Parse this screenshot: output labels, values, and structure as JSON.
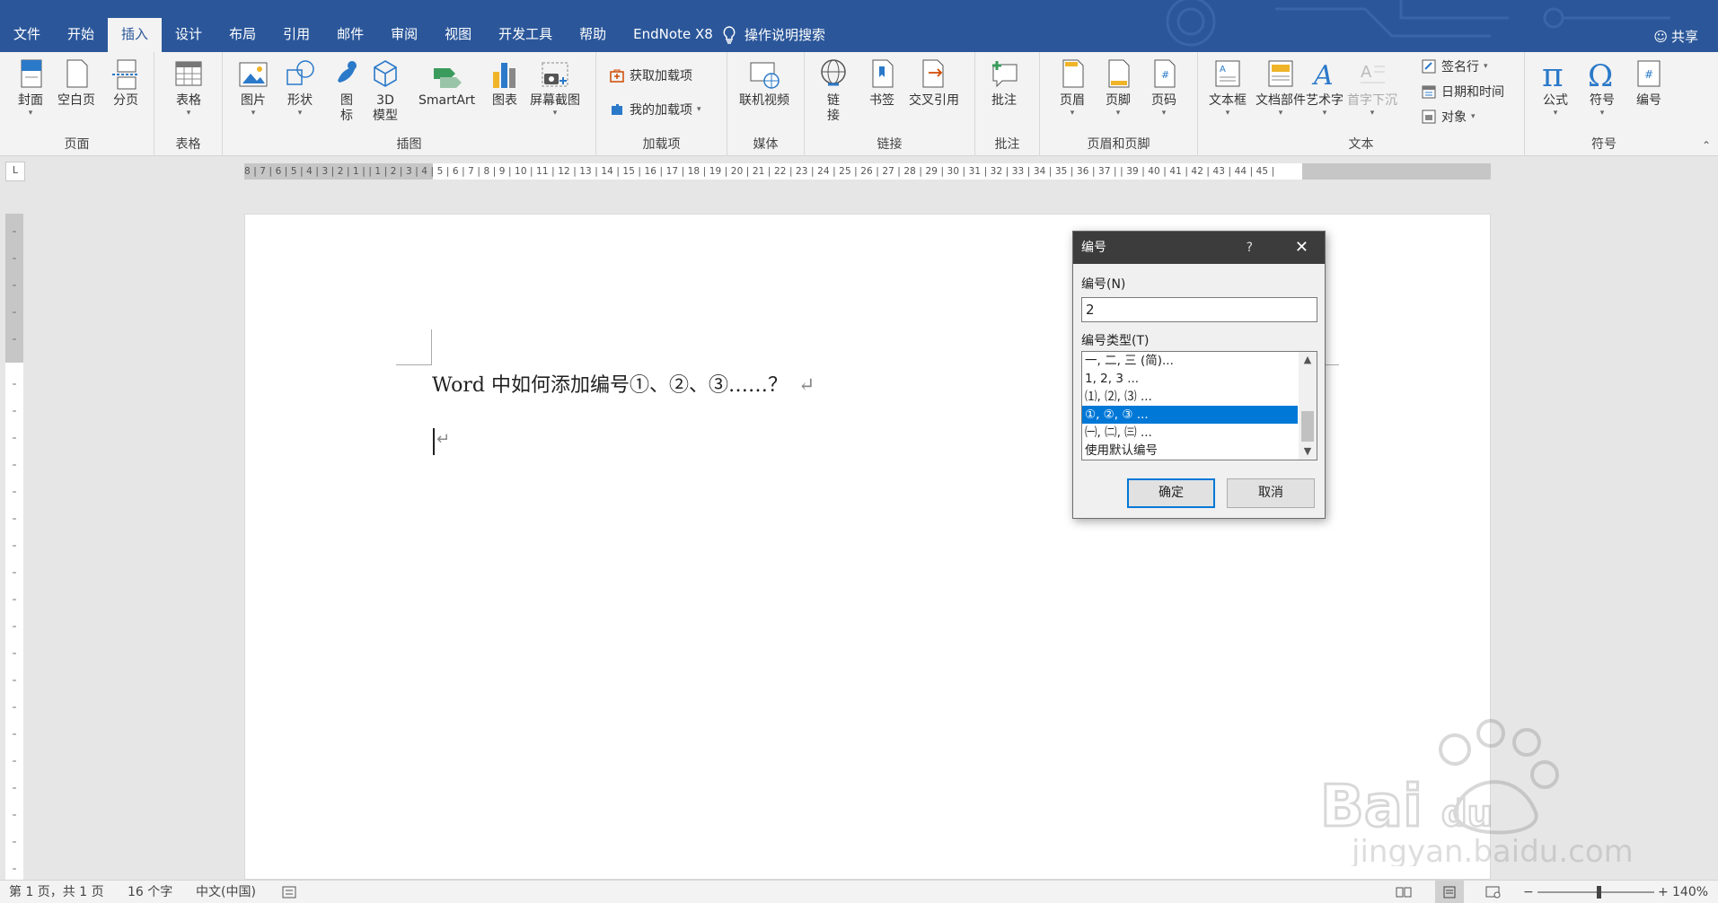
{
  "tabs": [
    "文件",
    "开始",
    "插入",
    "设计",
    "布局",
    "引用",
    "邮件",
    "审阅",
    "视图",
    "开发工具",
    "帮助",
    "EndNote X8"
  ],
  "active_tab": "插入",
  "tell_me": "操作说明搜索",
  "share": "共享",
  "ribbon": {
    "groups": {
      "pages": "页面",
      "tables": "表格",
      "illustrations": "插图",
      "addins": "加载项",
      "media": "媒体",
      "links": "链接",
      "comments": "批注",
      "header_footer": "页眉和页脚",
      "text": "文本",
      "symbols": "符号"
    },
    "buttons": {
      "cover": "封面",
      "blank_page": "空白页",
      "page_break": "分页",
      "table": "表格",
      "picture": "图片",
      "shapes": "形状",
      "icons": "图标",
      "model3d": "3D模型",
      "smartart": "SmartArt",
      "chart": "图表",
      "screenshot": "屏幕截图",
      "get_addins": "获取加载项",
      "my_addins": "我的加载项",
      "online_video": "联机视频",
      "link": "链接",
      "bookmark": "书签",
      "cross_ref": "交叉引用",
      "comment": "批注",
      "header": "页眉",
      "footer": "页脚",
      "page_number": "页码",
      "text_box": "文本框",
      "quick_parts": "文档部件",
      "wordart": "艺术字",
      "drop_cap": "首字下沉",
      "signature": "签名行",
      "date_time": "日期和时间",
      "object": "对象",
      "equation": "公式",
      "symbol": "符号",
      "number": "编号"
    }
  },
  "ruler": {
    "numbers": "8 | 7 | 6 | 5 | 4 | 3 | 2 | 1 |   | 1 | 2 | 3 | 4 | 5 | 6 | 7 | 8 | 9 | 10 | 11 | 12 | 13 | 14 | 15 | 16 | 17 | 18 | 19 | 20 | 21 | 22 | 23 | 24 | 25 | 26 | 27 | 28 | 29 | 30 | 31 | 32 | 33 | 34 | 35 | 36 | 37 |   | 39 | 40 | 41 | 42 | 43 | 44 | 45 |",
    "corner": "L"
  },
  "document": {
    "line1": "Word 中如何添加编号①、②、③……？",
    "para_mark": "↵"
  },
  "dialog": {
    "title": "编号",
    "help": "?",
    "close": "✕",
    "number_label": "编号(N)",
    "number_value": "2",
    "type_label": "编号类型(T)",
    "types": [
      "一, 二, 三 (简)...",
      "1, 2, 3 ...",
      "⑴, ⑵, ⑶ ...",
      "①, ②, ③ ...",
      "㈠, ㈡, ㈢ ...",
      "使用默认编号"
    ],
    "selected_index": 3,
    "ok": "确定",
    "cancel": "取消"
  },
  "status": {
    "page": "第 1 页，共 1 页",
    "words": "16 个字",
    "language": "中文(中国)",
    "zoom": "140%"
  },
  "colors": {
    "title_bar": "#2b579a",
    "selection": "#0078d7",
    "ribbon": "#f3f3f3"
  }
}
